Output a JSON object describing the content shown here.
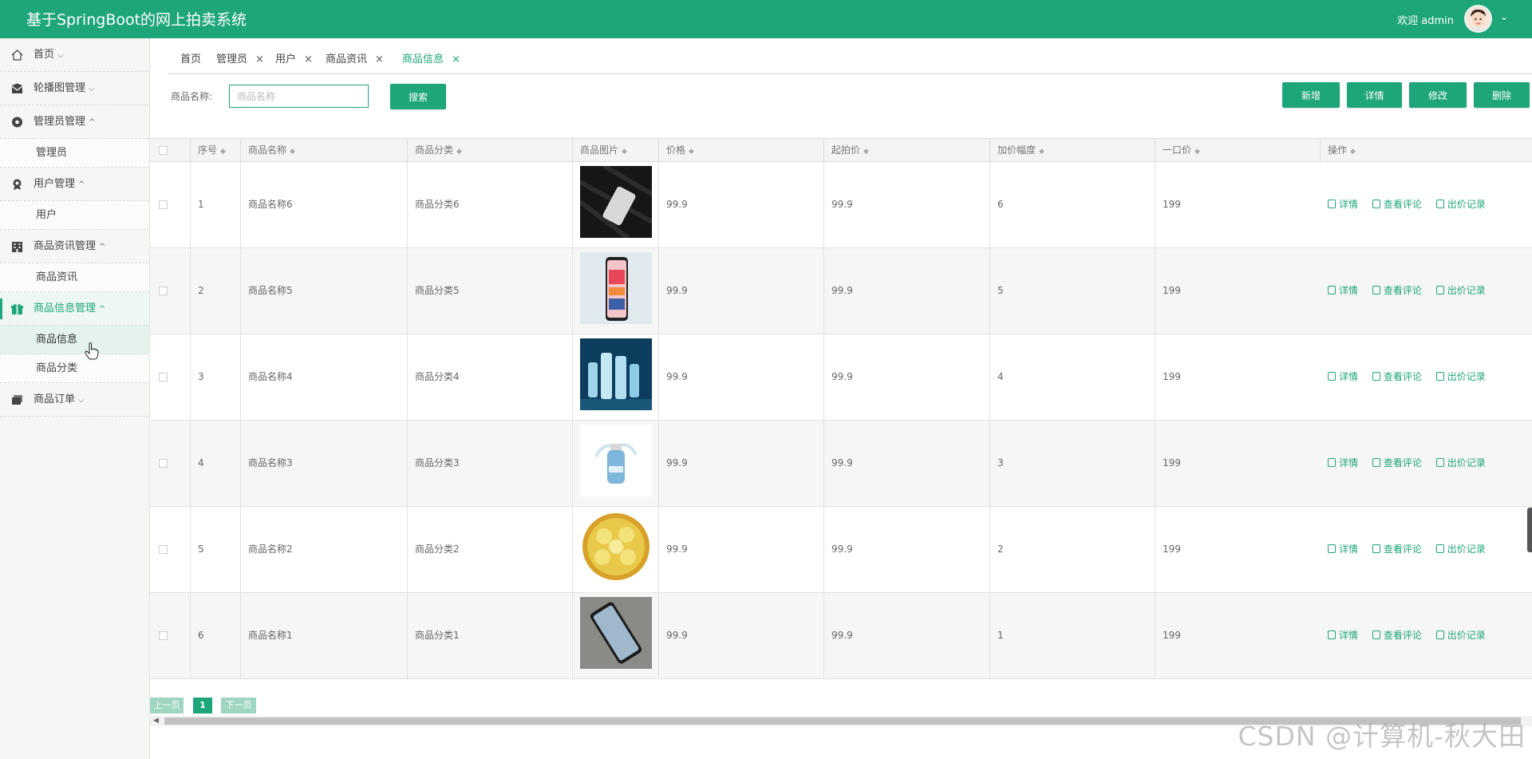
{
  "app": {
    "title": "基于SpringBoot的网上拍卖系统"
  },
  "header": {
    "welcome": "欢迎 admin"
  },
  "sidebar": {
    "items": [
      {
        "label": "首页",
        "icon": "home-icon",
        "expanded": false
      },
      {
        "label": "轮播图管理",
        "icon": "mail-icon",
        "expanded": false
      },
      {
        "label": "管理员管理",
        "icon": "circle-icon",
        "expanded": true,
        "children": [
          "管理员"
        ]
      },
      {
        "label": "用户管理",
        "icon": "user-badge-icon",
        "expanded": true,
        "children": [
          "用户"
        ]
      },
      {
        "label": "商品资讯管理",
        "icon": "building-icon",
        "expanded": true,
        "children": [
          "商品资讯"
        ]
      },
      {
        "label": "商品信息管理",
        "icon": "gift-icon",
        "expanded": true,
        "active": true,
        "children": [
          "商品信息",
          "商品分类"
        ]
      },
      {
        "label": "商品订单",
        "icon": "folder-icon",
        "expanded": false
      }
    ]
  },
  "tabs": [
    {
      "label": "首页",
      "closable": false
    },
    {
      "label": "管理员",
      "closable": true
    },
    {
      "label": "用户",
      "closable": true
    },
    {
      "label": "商品资讯",
      "closable": true
    },
    {
      "label": "商品信息",
      "closable": true,
      "active": true
    }
  ],
  "search": {
    "label": "商品名称:",
    "placeholder": "商品名称",
    "button": "搜索"
  },
  "toolbar": {
    "add": "新增",
    "detail": "详情",
    "edit": "修改",
    "delete": "删除"
  },
  "table": {
    "columns": [
      "序号",
      "商品名称",
      "商品分类",
      "商品图片",
      "价格",
      "起拍价",
      "加价幅度",
      "一口价",
      "操作"
    ],
    "actions": [
      "详情",
      "查看评论",
      "出价记录"
    ],
    "rows": [
      {
        "index": "1",
        "name": "商品名称6",
        "category": "商品分类6",
        "image": "black-phone",
        "price": "99.9",
        "start_price": "99.9",
        "increment": "6",
        "buyout": "199"
      },
      {
        "index": "2",
        "name": "商品名称5",
        "category": "商品分类5",
        "image": "pink-phone",
        "price": "99.9",
        "start_price": "99.9",
        "increment": "5",
        "buyout": "199"
      },
      {
        "index": "3",
        "name": "商品名称4",
        "category": "商品分类4",
        "image": "bottles",
        "price": "99.9",
        "start_price": "99.9",
        "increment": "4",
        "buyout": "199"
      },
      {
        "index": "4",
        "name": "商品名称3",
        "category": "商品分类3",
        "image": "blue-bottle",
        "price": "99.9",
        "start_price": "99.9",
        "increment": "3",
        "buyout": "199"
      },
      {
        "index": "5",
        "name": "商品名称2",
        "category": "商品分类2",
        "image": "lemons",
        "price": "99.9",
        "start_price": "99.9",
        "increment": "2",
        "buyout": "199"
      },
      {
        "index": "6",
        "name": "商品名称1",
        "category": "商品分类1",
        "image": "silver-phone",
        "price": "99.9",
        "start_price": "99.9",
        "increment": "1",
        "buyout": "199"
      }
    ]
  },
  "pagination": {
    "prev": "上一页",
    "current": "1",
    "next": "下一页"
  },
  "watermark": "CSDN @计算机-秋大田",
  "colors": {
    "primary": "#1ea67a",
    "sidebar_bg": "#f6f6f4"
  }
}
